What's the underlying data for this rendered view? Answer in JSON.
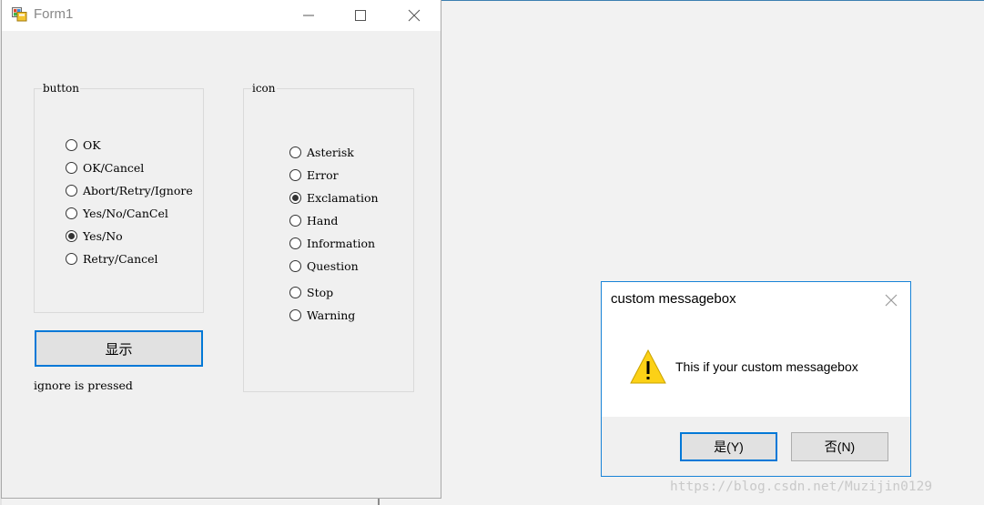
{
  "form": {
    "title": "Form1",
    "button_group": {
      "legend": "button",
      "options": [
        {
          "label": "OK",
          "checked": false
        },
        {
          "label": "OK/Cancel",
          "checked": false
        },
        {
          "label": "Abort/Retry/Ignore",
          "checked": false
        },
        {
          "label": "Yes/No/CanCel",
          "checked": false
        },
        {
          "label": "Yes/No",
          "checked": true
        },
        {
          "label": "Retry/Cancel",
          "checked": false
        }
      ]
    },
    "icon_group": {
      "legend": "icon",
      "options": [
        {
          "label": "Asterisk",
          "checked": false
        },
        {
          "label": "Error",
          "checked": false
        },
        {
          "label": "Exclamation",
          "checked": true
        },
        {
          "label": "Hand",
          "checked": false
        },
        {
          "label": "Information",
          "checked": false
        },
        {
          "label": "Question",
          "checked": false
        },
        {
          "label": "Stop",
          "checked": false
        },
        {
          "label": "Warning",
          "checked": false
        }
      ]
    },
    "show_button_label": "显示",
    "status_text": "ignore is pressed"
  },
  "messagebox": {
    "title": "custom messagebox",
    "message": "This if your custom messagebox",
    "icon": "warning-icon",
    "yes_label": "是(Y)",
    "no_label": "否(N)"
  },
  "watermark": "https://blog.csdn.net/Muzijin0129",
  "colors": {
    "accent": "#0078d7",
    "window_bg": "#f0f0f0",
    "warning_yellow": "#fcd116"
  }
}
